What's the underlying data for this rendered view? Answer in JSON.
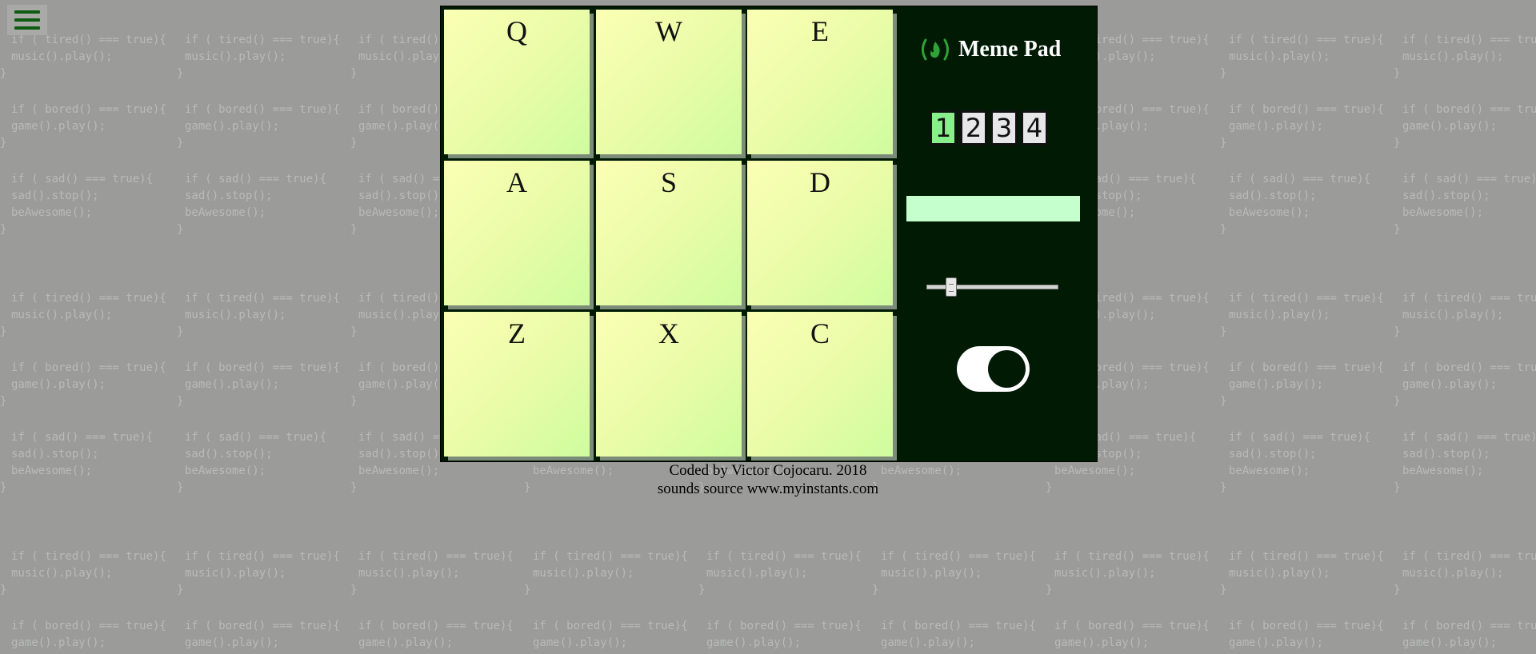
{
  "menu": {
    "icon": "hamburger-menu-icon"
  },
  "pad": {
    "keys": [
      {
        "label": "Q"
      },
      {
        "label": "W"
      },
      {
        "label": "E"
      },
      {
        "label": "A"
      },
      {
        "label": "S"
      },
      {
        "label": "D"
      },
      {
        "label": "Z"
      },
      {
        "label": "X"
      },
      {
        "label": "C"
      }
    ]
  },
  "side": {
    "title": "Meme Pad",
    "logo_icon": "freecodecamp-fire-icon",
    "banks": [
      "1",
      "2",
      "3",
      "4"
    ],
    "active_bank": "1",
    "display_text": "",
    "volume": 0.15,
    "power_on": true
  },
  "footer": {
    "line1": "Coded by Victor Cojocaru. 2018",
    "line2": "sounds source www.myinstants.com"
  },
  "background": {
    "snippets": [
      [
        "if ( tired() === true){",
        "music().play();",
        "}"
      ],
      [
        "if ( bored() === true){",
        "game().play();",
        "}"
      ],
      [
        "if ( sad() === true){",
        "sad().stop();",
        "beAwesome();",
        "}"
      ]
    ]
  },
  "colors": {
    "page_bg": "#9b9c9a",
    "pad_bg": "#001a04",
    "key_yellow": "#fbffb4",
    "key_green": "#cffc9e",
    "active_bank": "#87f08b",
    "display_bg": "#c6ffce",
    "accent_green": "#0d5c12"
  }
}
